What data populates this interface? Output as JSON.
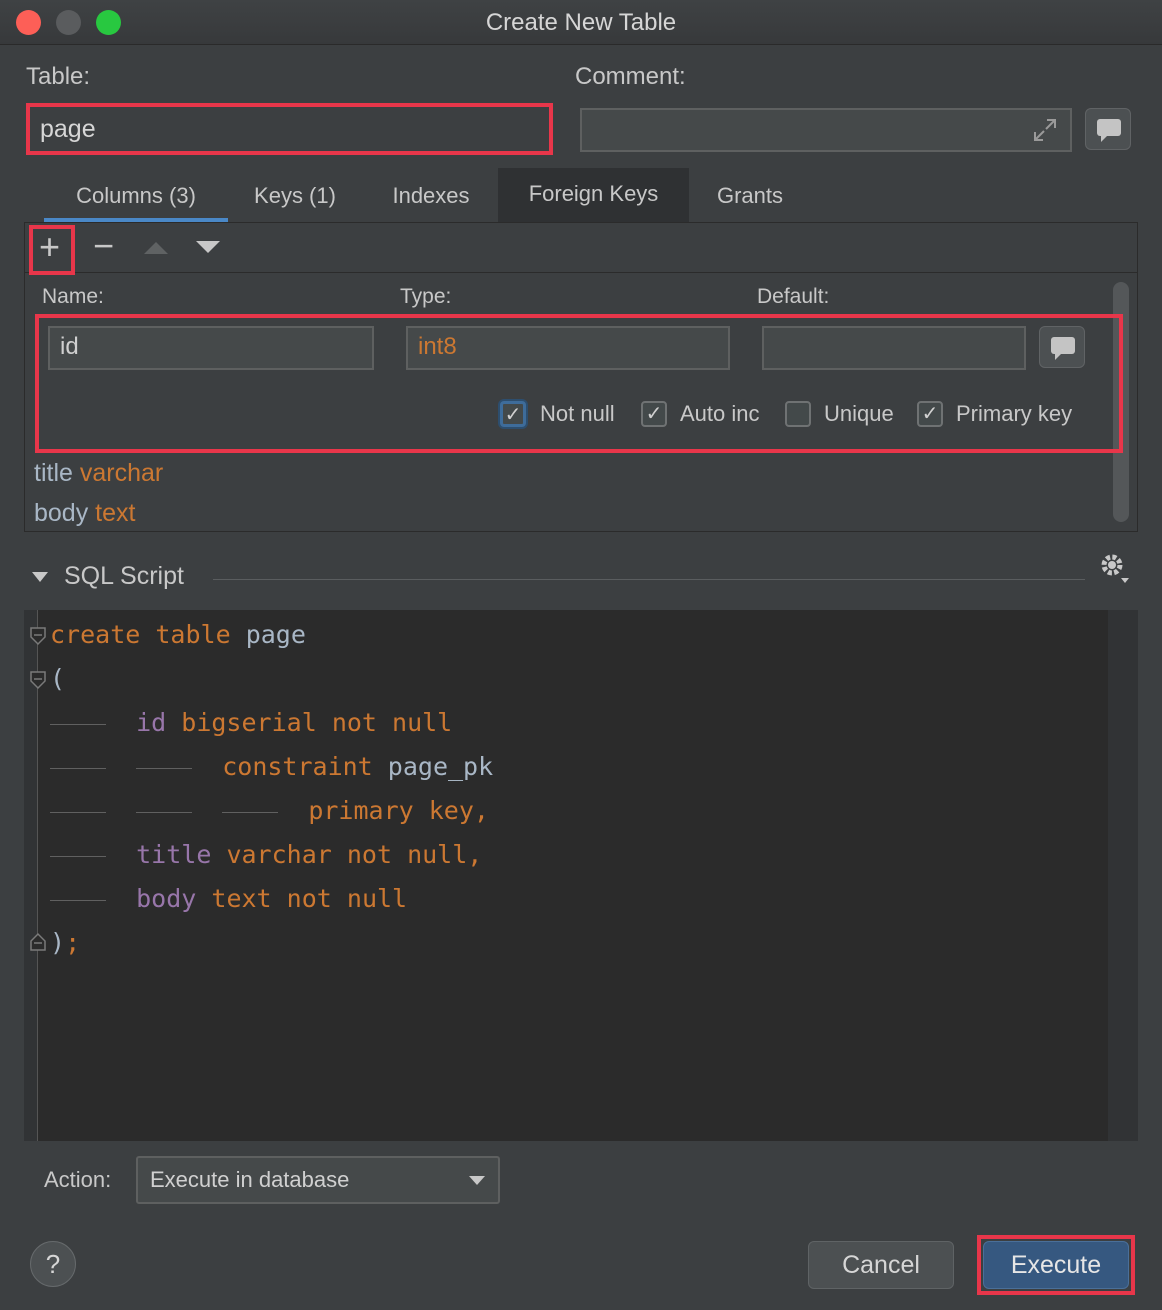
{
  "window": {
    "title": "Create New Table"
  },
  "table_field": {
    "label": "Table:",
    "value": "page"
  },
  "comment_field": {
    "label": "Comment:",
    "value": ""
  },
  "tabs": [
    {
      "label": "Columns (3)"
    },
    {
      "label": "Keys (1)"
    },
    {
      "label": "Indexes"
    },
    {
      "label": "Foreign Keys"
    },
    {
      "label": "Grants"
    }
  ],
  "toolbar": {
    "add": "+",
    "remove": "−"
  },
  "column_editor": {
    "name_label": "Name:",
    "type_label": "Type:",
    "default_label": "Default:",
    "name": "id",
    "type": "int8",
    "default": "",
    "checks": [
      {
        "label": "Not null",
        "checked": true
      },
      {
        "label": "Auto inc",
        "checked": true
      },
      {
        "label": "Unique",
        "checked": false
      },
      {
        "label": "Primary key",
        "checked": true
      }
    ]
  },
  "columns": [
    {
      "name": "title",
      "type": "varchar"
    },
    {
      "name": "body",
      "type": "text"
    }
  ],
  "sql": {
    "header": "SQL Script",
    "lines": {
      "l1a": "create",
      "l1b": "table",
      "l1c": "page",
      "l2": "(",
      "l3a": "id",
      "l3b": "bigserial",
      "l3c": "not",
      "l3d": "null",
      "l4a": "constraint",
      "l4b": "page_pk",
      "l5a": "primary",
      "l5b": "key,",
      "l6a": "title",
      "l6b": "varchar",
      "l6c": "not",
      "l6d": "null,",
      "l7a": "body",
      "l7b": "text",
      "l7c": "not",
      "l7d": "null",
      "l8a": ")",
      "l8b": ";"
    }
  },
  "action": {
    "label": "Action:",
    "value": "Execute in database"
  },
  "buttons": {
    "help": "?",
    "cancel": "Cancel",
    "execute": "Execute"
  },
  "colors": {
    "highlight": "#e8364a",
    "accent": "#4a88c7",
    "keyword": "#cc7832",
    "identifier": "#9876aa"
  }
}
